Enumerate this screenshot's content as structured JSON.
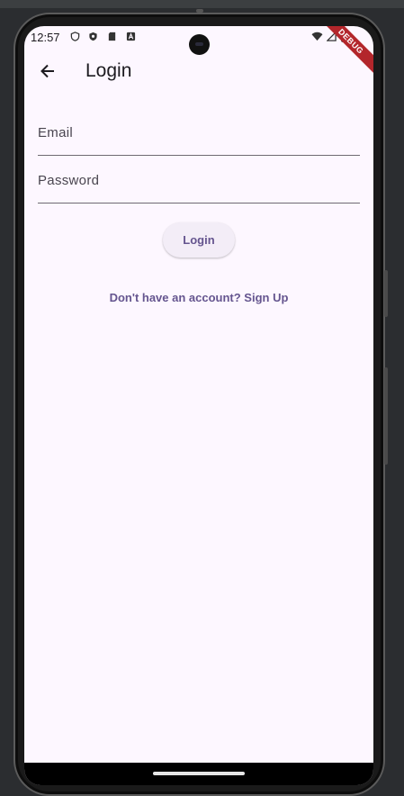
{
  "status_bar": {
    "time": "12:57",
    "debug_label": "DEBUG"
  },
  "app_bar": {
    "title": "Login",
    "back_icon": "arrow-back-icon"
  },
  "form": {
    "email_label": "Email",
    "password_label": "Password",
    "login_button": "Login",
    "signup_link": "Don't have an account? Sign Up"
  },
  "colors": {
    "background": "#fdf7ff",
    "accent": "#65558f",
    "button_bg": "#f3edf7",
    "debug_ribbon": "#b3262b"
  }
}
